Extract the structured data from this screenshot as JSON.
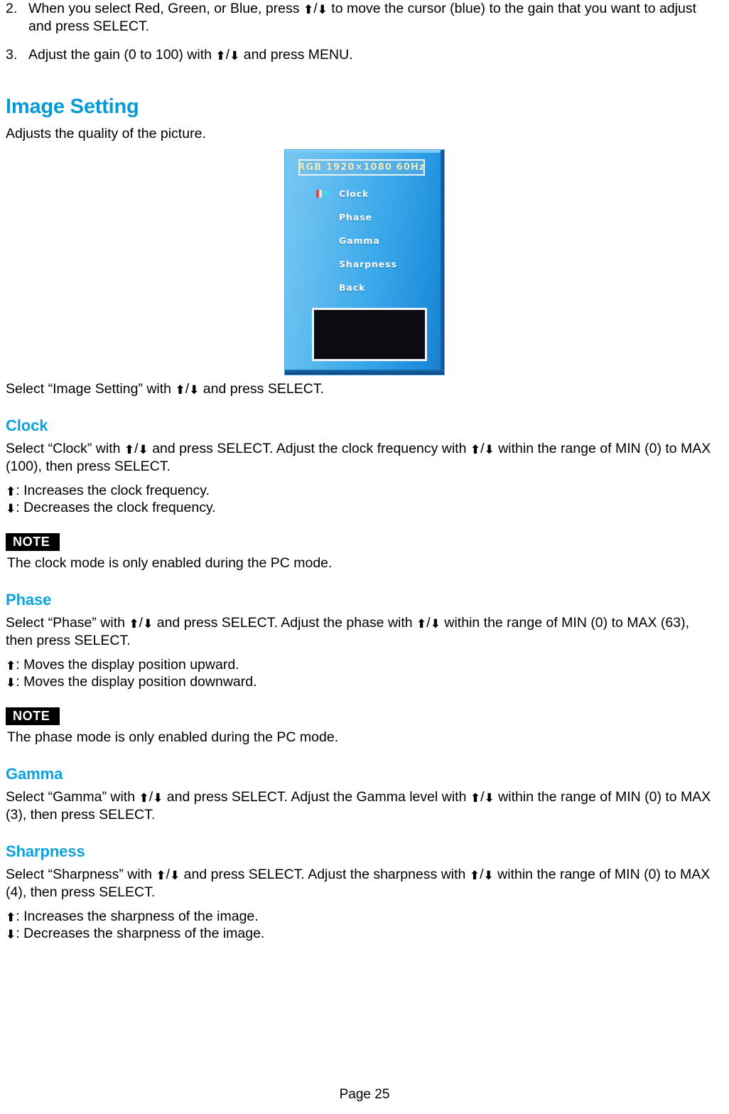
{
  "arrows": {
    "up": "⬆",
    "down": "⬇",
    "separator": "/"
  },
  "colors": {
    "heading_blue": "#039ad6",
    "subheading_blue": "#0ba3de",
    "note_badge_bg": "#000000",
    "osd_title_text": "#f2eec4",
    "osd_menu_text": "#ffffff",
    "cursor_red": "#e0443a",
    "cursor_cyan": "#3ddbe6"
  },
  "steps": [
    {
      "number": "2.",
      "text_before": "When you select Red, Green, or Blue, press ",
      "text_after": " to move the cursor (blue) to the gain that you want to adjust and press SELECT."
    },
    {
      "number": "3.",
      "text_before": "Adjust the gain (0 to 100) with ",
      "text_after": " and press MENU."
    }
  ],
  "image_setting": {
    "heading": "Image Setting",
    "intro": "Adjusts the quality of the picture.",
    "caption_before": "Select “Image Setting” with ",
    "caption_after": " and press SELECT."
  },
  "osd": {
    "title": "RGB  1920×1080  60Hz",
    "menu_items": [
      {
        "label": "Clock",
        "selected": true
      },
      {
        "label": "Phase",
        "selected": false
      },
      {
        "label": "Gamma",
        "selected": false
      },
      {
        "label": "Sharpness",
        "selected": false
      },
      {
        "label": "Back",
        "selected": false
      }
    ]
  },
  "clock": {
    "heading": "Clock",
    "desc_1": "Select “Clock” with ",
    "desc_2": " and press SELECT. Adjust the clock frequency with ",
    "desc_3": " within the range of MIN (0) to MAX (100), then press SELECT.",
    "up_text": ": Increases the clock frequency.",
    "down_text": ": Decreases the clock frequency.",
    "note_label": "NOTE",
    "note_text": "The clock mode is only enabled during the PC mode."
  },
  "phase": {
    "heading": "Phase",
    "desc_1": "Select “Phase” with ",
    "desc_2": " and press SELECT. Adjust the phase with ",
    "desc_3": " within the range of MIN (0) to MAX (63), then press SELECT.",
    "up_text": ": Moves the display position upward.",
    "down_text": ": Moves the display position downward.",
    "note_label": "NOTE",
    "note_text": "The phase mode is only enabled during the PC mode."
  },
  "gamma": {
    "heading": "Gamma",
    "desc_1": "Select “Gamma” with ",
    "desc_2": " and press SELECT. Adjust the Gamma level with ",
    "desc_3": " within the range of MIN (0) to MAX (3), then press SELECT."
  },
  "sharpness": {
    "heading": "Sharpness",
    "desc_1": "Select “Sharpness” with ",
    "desc_2": " and press SELECT. Adjust the sharpness with ",
    "desc_3": " within the range of MIN (0) to MAX (4), then press SELECT.",
    "up_text": ": Increases the sharpness of the image.",
    "down_text": ": Decreases the sharpness of the image."
  },
  "footer": {
    "page_label": "Page 25"
  }
}
